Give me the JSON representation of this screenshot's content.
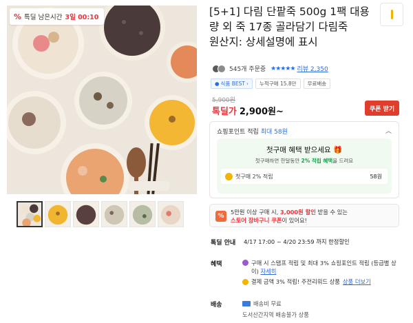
{
  "product": {
    "image_alt": "다림 단팥죽 외 죽 17종",
    "timer": {
      "prefix": "특딜 남은시간",
      "value": "3일 00:10"
    },
    "thumbnails": [
      "porridge-assortment",
      "pumpkin-porridge",
      "red-bean-porridge",
      "vegetable-porridge",
      "abalone-porridge",
      "shrimp-porridge"
    ],
    "title": "[5+1] 다림 단팥죽 500g 1팩 대용량 외 죽 17종 골라담기 다림죽\n원산지: 상세설명에 표시",
    "rating": {
      "count_text": "545개 주문중",
      "stars": "★★★★★",
      "reviews_label": "리뷰 2,350"
    },
    "chips": {
      "best": "식품 BEST",
      "cumulative": "누적구매 15.8만",
      "free_shipping": "무료배송"
    },
    "original_price": "5,900원",
    "price_label": "톡딜가",
    "price_value": "2,900원~",
    "coupon_button": "쿠폰 받기"
  },
  "points": {
    "header": "쇼핑포인트 적립",
    "header_max": "최대 58원",
    "first_title": "첫구매 혜택 받으세요",
    "first_sub_before": "첫구매하면 한달동안",
    "first_sub_highlight": "2% 적립 혜택",
    "first_sub_after": "을 드려요",
    "row_label": "첫구매 2% 적립",
    "row_value": "58원"
  },
  "promo": {
    "line1_before": "5만원 이상 구매 시,",
    "line1_red": "3,000원 할인",
    "line1_after": "받을 수 있는",
    "line2_red": "스토어 장바구니 쿠폰",
    "line2_after": "이 있어요!"
  },
  "deal": {
    "label": "톡딜 안내",
    "text": "4/17 17:00 ~ 4/20 23:59 까지 한정할인"
  },
  "benefit": {
    "label": "혜택",
    "line1": "구매 시 스탬프 적립 및 최대 3% 쇼핑포인트 적립 (등급별 상이)",
    "line1_link": "자세히",
    "line2": "결제 금액 3% 적립! 주전리워드 상품",
    "line2_link": "상품 더보기"
  },
  "shipping": {
    "label": "배송",
    "line1": "배송비 무료",
    "line2": "도서산간지역 배송불가 상품"
  }
}
